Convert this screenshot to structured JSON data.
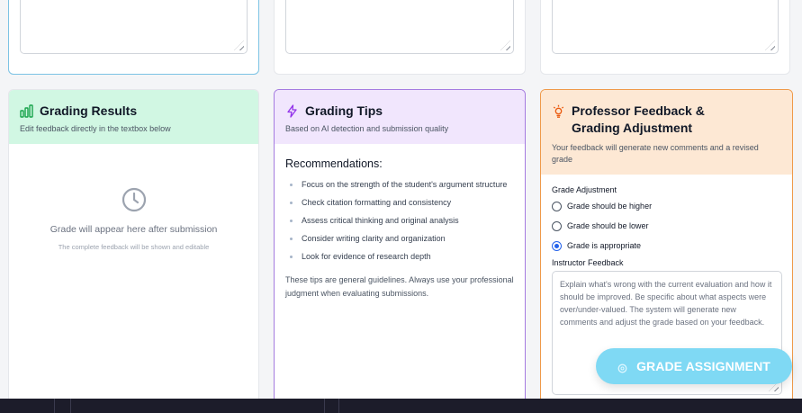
{
  "results": {
    "title": "Grading Results",
    "subtitle": "Edit feedback directly in the textbox below",
    "placeholder_main": "Grade will appear here after submission",
    "placeholder_sub": "The complete feedback will be shown and editable"
  },
  "tips": {
    "title": "Grading Tips",
    "subtitle": "Based on AI detection and submission quality",
    "heading": "Recommendations:",
    "items": [
      "Focus on the strength of the student's argument structure",
      "Check citation formatting and consistency",
      "Assess critical thinking and original analysis",
      "Consider writing clarity and organization",
      "Look for evidence of research depth"
    ],
    "note": "These tips are general guidelines. Always use your professional judgment when evaluating submissions."
  },
  "feedback": {
    "title": "Professor Feedback & Grading Adjustment",
    "subtitle": "Your feedback will generate new comments and a revised grade",
    "adjustment_label": "Grade Adjustment",
    "options": [
      {
        "label": "Grade should be higher",
        "checked": false
      },
      {
        "label": "Grade should be lower",
        "checked": false
      },
      {
        "label": "Grade is appropriate",
        "checked": true
      }
    ],
    "instructor_label": "Instructor Feedback",
    "textarea_placeholder": "Explain what's wrong with the current evaluation and how it should be improved. Be specific about what aspects were over/under-valued. The system will generate new comments and adjust the grade based on your feedback."
  },
  "grade_button": {
    "label": "GRADE ASSIGNMENT"
  },
  "colors": {
    "results_header": "#d1f7e3",
    "tips_header": "#f1e6fd",
    "feedback_header": "#fde8d4",
    "button": "#7fd9f4"
  }
}
